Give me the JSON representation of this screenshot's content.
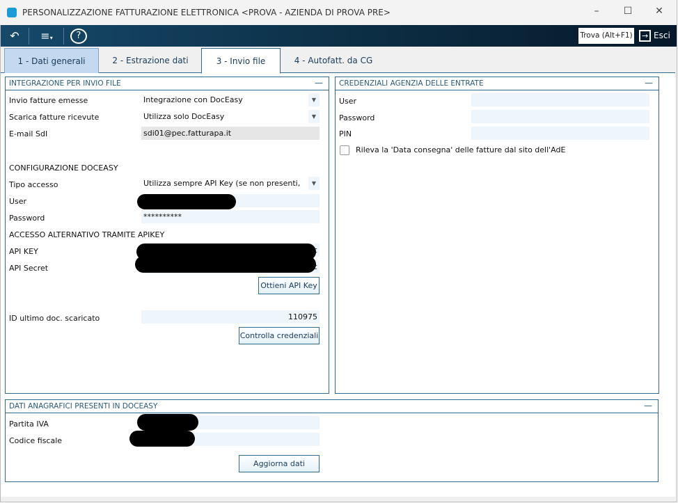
{
  "window": {
    "title": "PERSONALIZZAZIONE FATTURAZIONE ELETTRONICA <PROVA - AZIENDA DI PROVA PRE>"
  },
  "toolbar": {
    "back_icon": "undo-icon",
    "menu_icon": "menu-icon",
    "help_icon": "help-icon",
    "find_label": "Trova (Alt+F1)",
    "exit_label": "Esci"
  },
  "tabs": [
    {
      "label": "1 - Dati generali"
    },
    {
      "label": "2 - Estrazione dati"
    },
    {
      "label": "3 - Invio file"
    },
    {
      "label": "4 - Autofatt. da CG"
    }
  ],
  "integration": {
    "title": "INTEGRAZIONE PER INVIO FILE",
    "invio_label": "Invio fatture emesse",
    "invio_value": "Integrazione con DocEasy",
    "scarica_label": "Scarica fatture ricevute",
    "scarica_value": "Utilizza solo DocEasy",
    "email_label": "E-mail SdI",
    "email_value": "sdi01@pec.fatturapa.it",
    "config_title": "CONFIGURAZIONE DOCEASY",
    "tipo_label": "Tipo accesso",
    "tipo_value": "Utilizza sempre API Key (se non presenti, creale)",
    "user_label": "User",
    "password_label": "Password",
    "password_value": "**********",
    "alt_title": "ACCESSO ALTERNATIVO TRAMITE APIKEY",
    "apikey_label": "API KEY",
    "apikey_tail": "c",
    "apisecret_label": "API Secret",
    "apisecret_tail": "c",
    "get_api_key_button": "Ottieni API Key",
    "last_id_label": "ID ultimo doc. scaricato",
    "last_id_value": "110975",
    "check_button": "Controlla credenziali"
  },
  "agency": {
    "title": "CREDENZIALI AGENZIA DELLE ENTRATE",
    "user_label": "User",
    "password_label": "Password",
    "pin_label": "PIN",
    "checkbox_label": "Rileva la 'Data consegna' delle fatture dal sito dell'AdE"
  },
  "registry": {
    "title": "DATI ANAGRAFICI PRESENTI IN DOCEASY",
    "piva_label": "Partita IVA",
    "cf_label": "Codice fiscale",
    "update_button": "Aggiorna dati"
  }
}
